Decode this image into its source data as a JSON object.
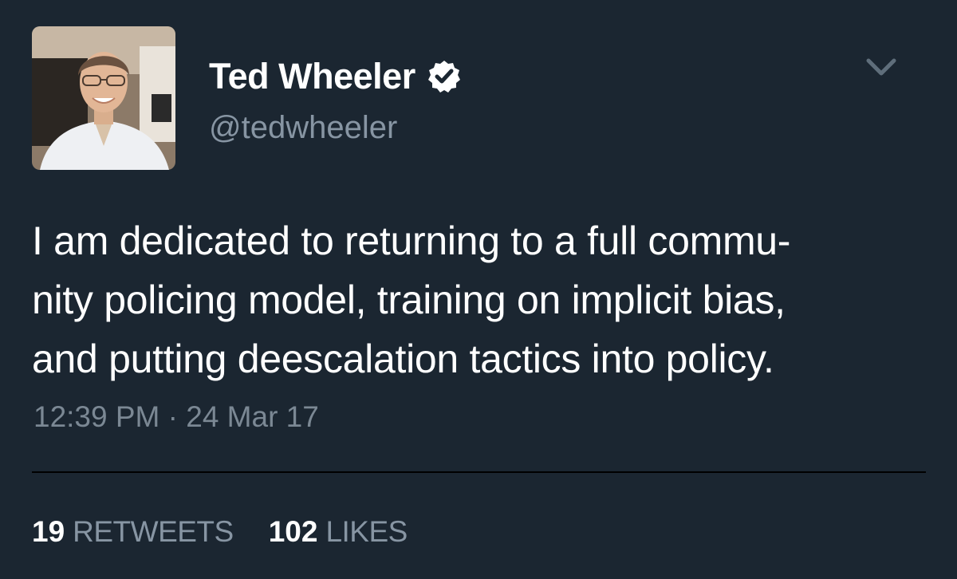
{
  "tweet": {
    "author": {
      "display_name": "Ted Wheeler",
      "handle": "@tedwheeler",
      "verified": true,
      "avatar_icon": "profile-photo"
    },
    "text": "I am dedicated to returning to a full commu-\nnity policing model, training on implicit bias,\nand putting deescalation tactics into policy.",
    "timestamp": "12:39 PM · 24 Mar 17",
    "stats": {
      "retweets_count": "19",
      "retweets_label": "RETWEETS",
      "likes_count": "102",
      "likes_label": "LIKES"
    },
    "menu_icon": "chevron-down-icon"
  },
  "colors": {
    "background": "#1b2631",
    "text_primary": "#ffffff",
    "text_secondary": "#8795a3",
    "divider": "#000000"
  }
}
